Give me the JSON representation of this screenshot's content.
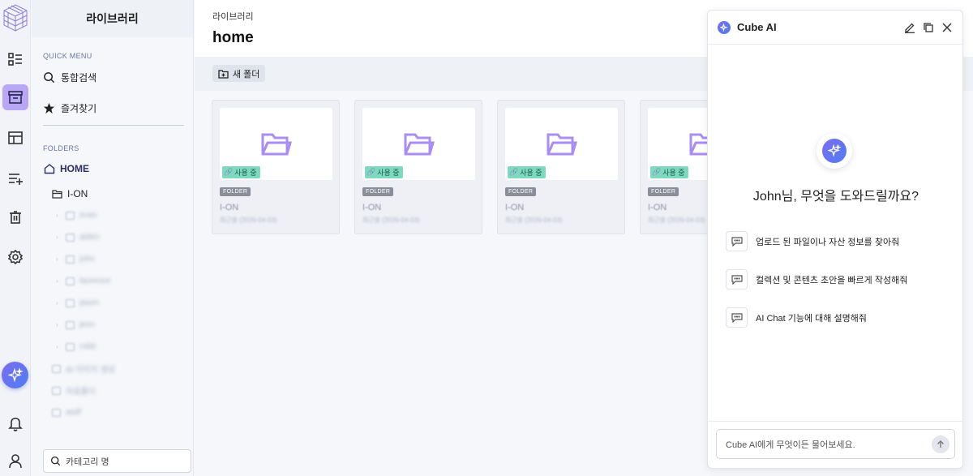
{
  "sidebar": {
    "title": "라이브러리",
    "quick_menu_label": "QUICK MENU",
    "quick_menu": [
      {
        "label": "통합검색",
        "icon": "search-icon"
      },
      {
        "label": "즐겨찾기",
        "icon": "star-icon"
      }
    ],
    "folders_label": "FOLDERS",
    "home": "HOME",
    "ion": "I-ON",
    "sub_items": [
      "evan",
      "aiden",
      "john",
      "laurence",
      "jason",
      "jeon",
      "robb"
    ],
    "root_items": [
      "AI 이미지 생성",
      "자료폴더",
      "asdf"
    ],
    "category_placeholder": "카테고리 명"
  },
  "main": {
    "breadcrumb": "라이브러리",
    "title": "home",
    "new_folder_label": "새 폴더",
    "cards": [
      {
        "badge_use": "사용 중",
        "type": "FOLDER",
        "name": "I-ON",
        "date": "최근용 (2026-04-03)"
      },
      {
        "badge_use": "사용 중",
        "type": "FOLDER",
        "name": "I-ON",
        "date": "최근용 (2026-04-03)"
      },
      {
        "badge_use": "사용 중",
        "type": "FOLDER",
        "name": "I-ON",
        "date": "최근용 (2026-04-03)"
      },
      {
        "badge_use": "사용 중",
        "type": "FOLDER",
        "name": "I-ON",
        "date": "최근용 (2026-04-03)"
      }
    ]
  },
  "ai": {
    "title": "Cube AI",
    "greeting": "John님, 무엇을 도와드릴까요?",
    "suggestions": [
      "업로드 된 파일이나 자산 정보를 찾아줘",
      "컬렉션 및 콘텐츠 초안을 빠르게 작성해줘",
      "AI Chat 기능에 대해 설명해줘"
    ],
    "input_placeholder": "Cube AI에게 무엇이든 물어보세요."
  },
  "colors": {
    "accent": "#7b6cf0",
    "folder_icon": "#a98df5",
    "badge_use": "#7fd9bf",
    "rail_active": "#b9a6f5"
  }
}
